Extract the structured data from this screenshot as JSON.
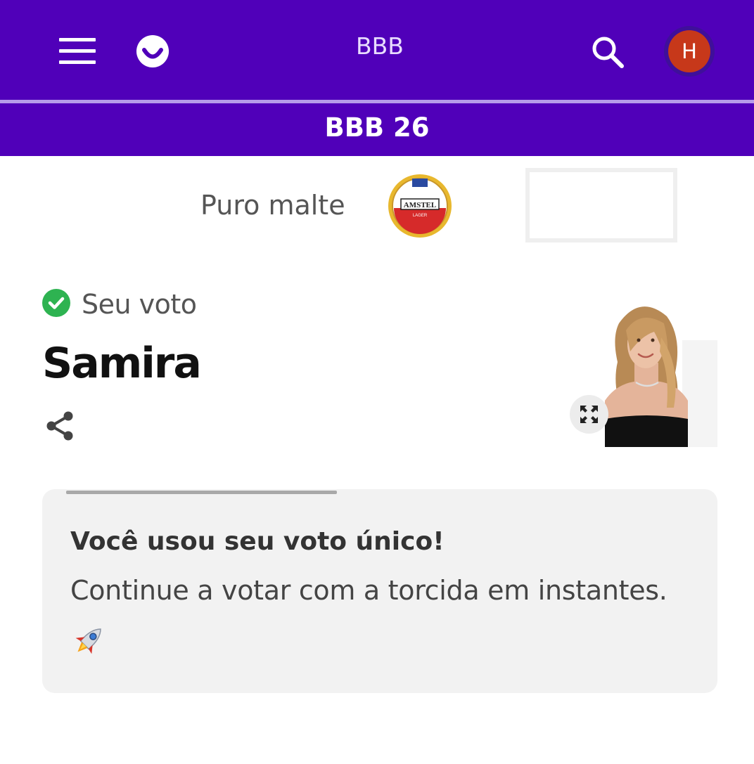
{
  "header": {
    "title": "BBB",
    "avatar_initial": "H",
    "menu_icon": "hamburger-menu-icon",
    "logo_icon": "smile-logo-icon",
    "search_icon": "search-icon"
  },
  "subheader": {
    "title": "BBB 26"
  },
  "sponsor": {
    "tagline": "Puro malte",
    "logo": "amstel-lager-logo"
  },
  "vote": {
    "status_label": "Seu voto",
    "candidate_name": "Samira",
    "share_icon": "share-icon",
    "expand_icon": "expand-icon"
  },
  "notice": {
    "title": "Você usou seu voto único!",
    "message": "Continue a votar com a torcida em instantes.",
    "emoji_icon": "rocket-icon"
  },
  "colors": {
    "brand": "#5000b9",
    "avatar": "#c7381a",
    "success": "#2eb351",
    "card_bg": "#f2f2f2"
  }
}
